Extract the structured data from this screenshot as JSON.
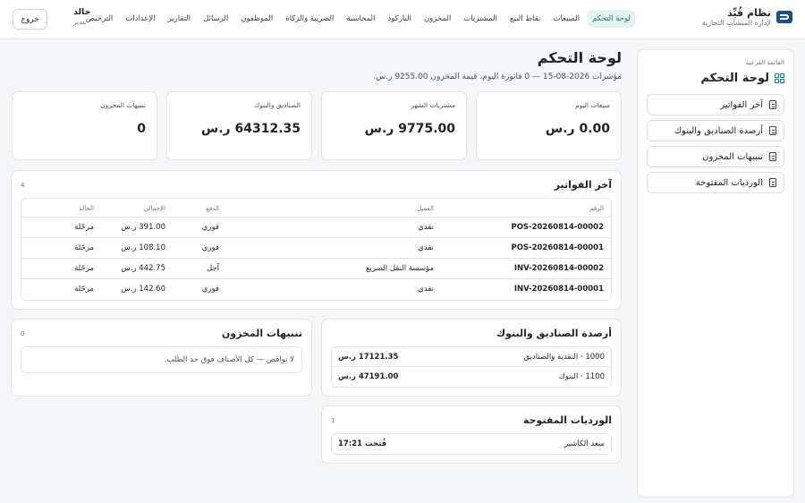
{
  "brand": {
    "name": "نظام قُيِّد",
    "subtitle": "لإدارة المنشآت التجارية"
  },
  "nav": [
    {
      "label": "لوحة التحكم",
      "active": true
    },
    {
      "label": "المبيعات"
    },
    {
      "label": "نقاط البيع"
    },
    {
      "label": "المشتريات"
    },
    {
      "label": "المخزون"
    },
    {
      "label": "الباركود"
    },
    {
      "label": "المحاسبة"
    },
    {
      "label": "الضريبة والزكاة"
    },
    {
      "label": "الموظفون"
    },
    {
      "label": "الرسائل"
    },
    {
      "label": "التقارير"
    },
    {
      "label": "الإعدادات"
    },
    {
      "label": "الترخيص"
    }
  ],
  "user": {
    "name": "خالد",
    "role": "مدير",
    "logout_label": "خروج"
  },
  "sidebar": {
    "caption": "القائمة الفرعية",
    "title": "لوحة التحكم",
    "items": [
      {
        "label": "آخر الفواتير"
      },
      {
        "label": "أرصدة الصناديق والبنوك"
      },
      {
        "label": "تنبيهات المخزون"
      },
      {
        "label": "الورديات المفتوحة"
      }
    ]
  },
  "page": {
    "title": "لوحة التحكم",
    "subtitle": "مؤشرات 2026-08-15 — 0 فاتورة اليوم، قيمة المخزون 9255.00 ر.س."
  },
  "kpis": [
    {
      "label": "مبيعات اليوم",
      "value": "0.00 ر.س"
    },
    {
      "label": "مشتريات الشهر",
      "value": "9775.00 ر.س"
    },
    {
      "label": "الصناديق والبنوك",
      "value": "64312.35 ر.س"
    },
    {
      "label": "تنبيهات المخزون",
      "value": "0"
    }
  ],
  "invoices": {
    "title": "آخر الفواتير",
    "count": "4",
    "headers": [
      "الرقم",
      "العميل",
      "الدفع",
      "الإجمالي",
      "الحالة"
    ],
    "rows": [
      [
        "POS-20260814-00002",
        "نقدي",
        "فوري",
        "391.00 ر.س",
        "مرحّلة"
      ],
      [
        "POS-20260814-00001",
        "نقدي",
        "فوري",
        "108.10 ر.س",
        "مرحّلة"
      ],
      [
        "INV-20260814-00002",
        "مؤسسة النقل السريع",
        "آجل",
        "442.75 ر.س",
        "مرحّلة"
      ],
      [
        "INV-20260814-00001",
        "نقدي",
        "فوري",
        "142.60 ر.س",
        "مرحّلة"
      ]
    ]
  },
  "balances": {
    "title": "أرصدة الصناديق والبنوك",
    "rows": [
      {
        "label": "1000 · النقدية والصناديق",
        "value": "17121.35 ر.س"
      },
      {
        "label": "1100 · البنوك",
        "value": "47191.00 ر.س"
      }
    ]
  },
  "stock_alerts": {
    "title": "تنبيهات المخزون",
    "count": "0",
    "empty": "لا نواقص — كل الأصناف فوق حد الطلب."
  },
  "shifts": {
    "title": "الورديات المفتوحة",
    "count": "1",
    "rows": [
      {
        "label": "سعد الكاشير",
        "value": "فُتحت 17:21"
      }
    ]
  }
}
